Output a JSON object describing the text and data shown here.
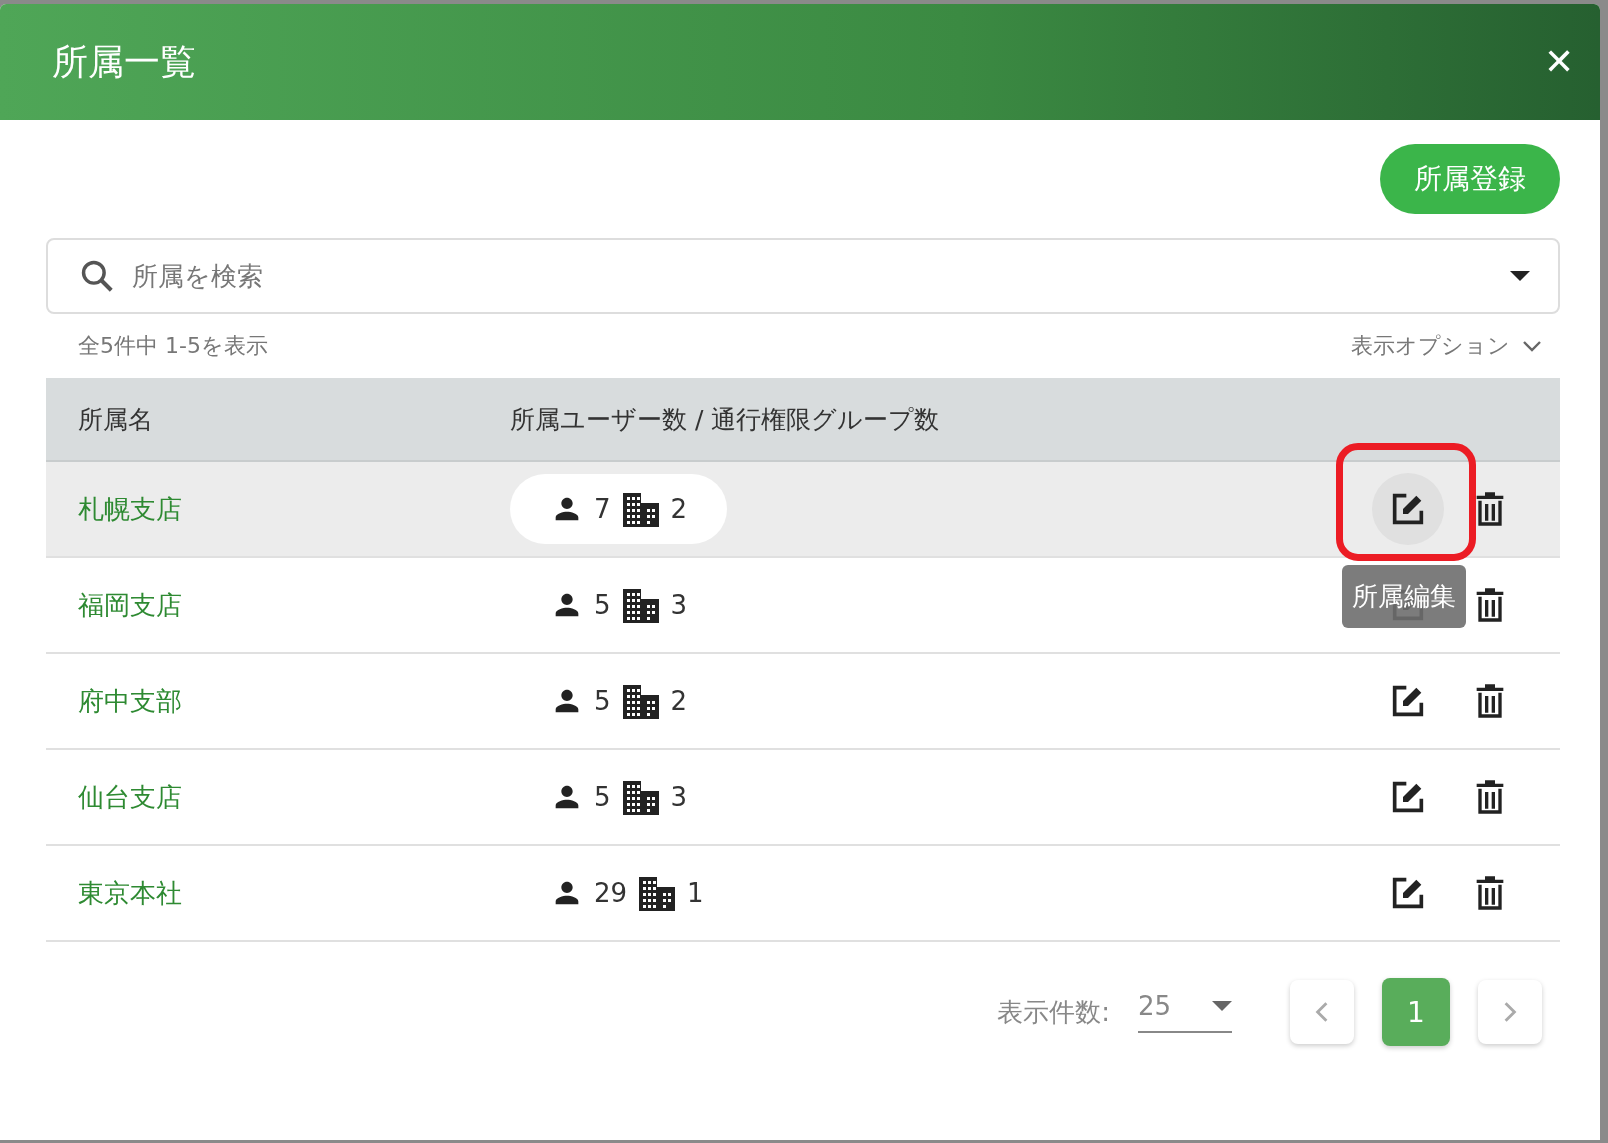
{
  "dialog": {
    "title": "所属一覧",
    "close": "✕"
  },
  "add_button": "所属登録",
  "search": {
    "placeholder": "所属を検索"
  },
  "summary": "全5件中 1-5を表示",
  "display_options": "表示オプション",
  "table": {
    "columns": [
      "所属名",
      "所属ユーザー数 / 通行権限グループ数"
    ],
    "rows": [
      {
        "name": "札幌支店",
        "users": "7",
        "groups": "2",
        "highlighted": true,
        "annotated": true,
        "tooltip": "所属編集"
      },
      {
        "name": "福岡支店",
        "users": "5",
        "groups": "3",
        "highlighted": false,
        "annotated": false
      },
      {
        "name": "府中支部",
        "users": "5",
        "groups": "2",
        "highlighted": false,
        "annotated": false
      },
      {
        "name": "仙台支店",
        "users": "5",
        "groups": "3",
        "highlighted": false,
        "annotated": false
      },
      {
        "name": "東京本社",
        "users": "29",
        "groups": "1",
        "highlighted": false,
        "annotated": false
      }
    ]
  },
  "pagination": {
    "per_page_label": "表示件数:",
    "per_page": "25",
    "pages": [
      {
        "label": "1",
        "selected": true
      }
    ]
  }
}
